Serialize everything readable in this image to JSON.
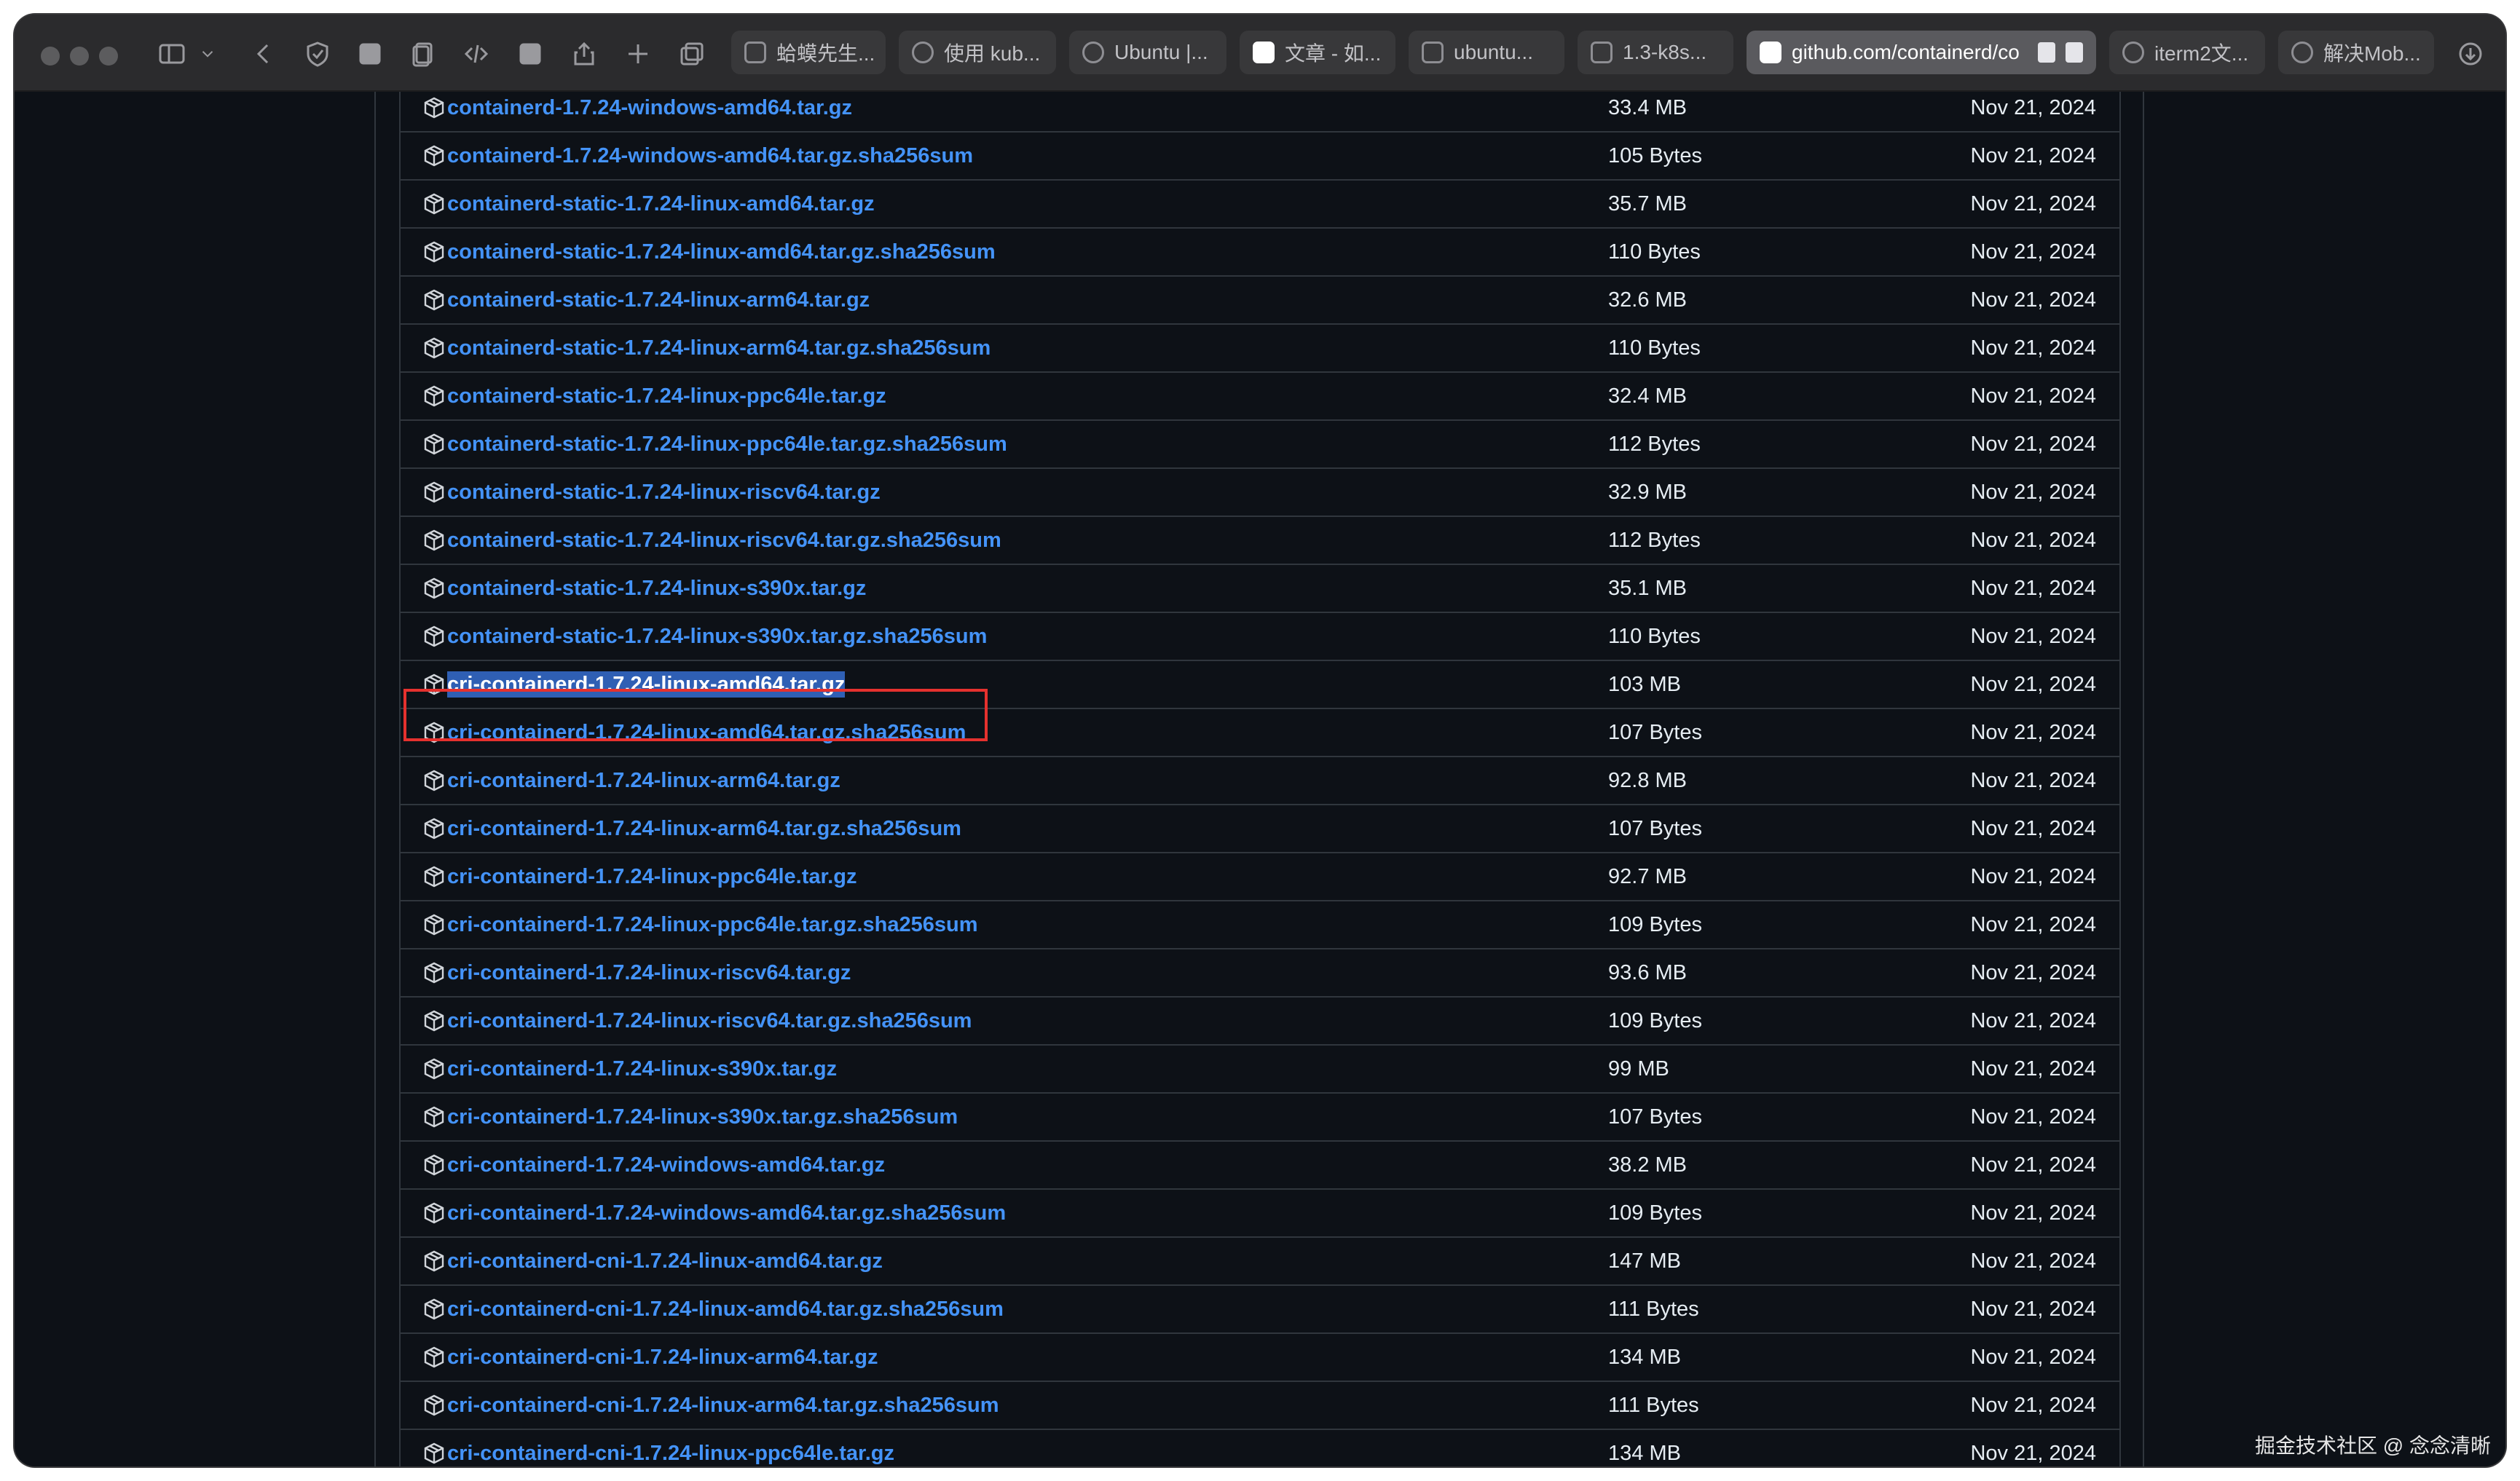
{
  "browser": {
    "tabs": [
      {
        "label": "蛤蟆先生..."
      },
      {
        "label": "使用 kub..."
      },
      {
        "label": "Ubuntu |..."
      },
      {
        "label": "文章 - 如..."
      },
      {
        "label": "ubuntu..."
      },
      {
        "label": "1.3-k8s..."
      },
      {
        "label": "github.com/containerd/co"
      },
      {
        "label": "iterm2文..."
      },
      {
        "label": "解决Mob..."
      }
    ],
    "active_tab_index": 6
  },
  "assets": [
    {
      "name": "containerd-1.7.24-windows-amd64.tar.gz",
      "size": "33.4 MB",
      "date": "Nov 21, 2024"
    },
    {
      "name": "containerd-1.7.24-windows-amd64.tar.gz.sha256sum",
      "size": "105 Bytes",
      "date": "Nov 21, 2024"
    },
    {
      "name": "containerd-static-1.7.24-linux-amd64.tar.gz",
      "size": "35.7 MB",
      "date": "Nov 21, 2024"
    },
    {
      "name": "containerd-static-1.7.24-linux-amd64.tar.gz.sha256sum",
      "size": "110 Bytes",
      "date": "Nov 21, 2024"
    },
    {
      "name": "containerd-static-1.7.24-linux-arm64.tar.gz",
      "size": "32.6 MB",
      "date": "Nov 21, 2024"
    },
    {
      "name": "containerd-static-1.7.24-linux-arm64.tar.gz.sha256sum",
      "size": "110 Bytes",
      "date": "Nov 21, 2024"
    },
    {
      "name": "containerd-static-1.7.24-linux-ppc64le.tar.gz",
      "size": "32.4 MB",
      "date": "Nov 21, 2024"
    },
    {
      "name": "containerd-static-1.7.24-linux-ppc64le.tar.gz.sha256sum",
      "size": "112 Bytes",
      "date": "Nov 21, 2024"
    },
    {
      "name": "containerd-static-1.7.24-linux-riscv64.tar.gz",
      "size": "32.9 MB",
      "date": "Nov 21, 2024"
    },
    {
      "name": "containerd-static-1.7.24-linux-riscv64.tar.gz.sha256sum",
      "size": "112 Bytes",
      "date": "Nov 21, 2024"
    },
    {
      "name": "containerd-static-1.7.24-linux-s390x.tar.gz",
      "size": "35.1 MB",
      "date": "Nov 21, 2024"
    },
    {
      "name": "containerd-static-1.7.24-linux-s390x.tar.gz.sha256sum",
      "size": "110 Bytes",
      "date": "Nov 21, 2024"
    },
    {
      "name": "cri-containerd-1.7.24-linux-amd64.tar.gz",
      "size": "103 MB",
      "date": "Nov 21, 2024"
    },
    {
      "name": "cri-containerd-1.7.24-linux-amd64.tar.gz.sha256sum",
      "size": "107 Bytes",
      "date": "Nov 21, 2024"
    },
    {
      "name": "cri-containerd-1.7.24-linux-arm64.tar.gz",
      "size": "92.8 MB",
      "date": "Nov 21, 2024"
    },
    {
      "name": "cri-containerd-1.7.24-linux-arm64.tar.gz.sha256sum",
      "size": "107 Bytes",
      "date": "Nov 21, 2024"
    },
    {
      "name": "cri-containerd-1.7.24-linux-ppc64le.tar.gz",
      "size": "92.7 MB",
      "date": "Nov 21, 2024"
    },
    {
      "name": "cri-containerd-1.7.24-linux-ppc64le.tar.gz.sha256sum",
      "size": "109 Bytes",
      "date": "Nov 21, 2024"
    },
    {
      "name": "cri-containerd-1.7.24-linux-riscv64.tar.gz",
      "size": "93.6 MB",
      "date": "Nov 21, 2024"
    },
    {
      "name": "cri-containerd-1.7.24-linux-riscv64.tar.gz.sha256sum",
      "size": "109 Bytes",
      "date": "Nov 21, 2024"
    },
    {
      "name": "cri-containerd-1.7.24-linux-s390x.tar.gz",
      "size": "99 MB",
      "date": "Nov 21, 2024"
    },
    {
      "name": "cri-containerd-1.7.24-linux-s390x.tar.gz.sha256sum",
      "size": "107 Bytes",
      "date": "Nov 21, 2024"
    },
    {
      "name": "cri-containerd-1.7.24-windows-amd64.tar.gz",
      "size": "38.2 MB",
      "date": "Nov 21, 2024"
    },
    {
      "name": "cri-containerd-1.7.24-windows-amd64.tar.gz.sha256sum",
      "size": "109 Bytes",
      "date": "Nov 21, 2024"
    },
    {
      "name": "cri-containerd-cni-1.7.24-linux-amd64.tar.gz",
      "size": "147 MB",
      "date": "Nov 21, 2024"
    },
    {
      "name": "cri-containerd-cni-1.7.24-linux-amd64.tar.gz.sha256sum",
      "size": "111 Bytes",
      "date": "Nov 21, 2024"
    },
    {
      "name": "cri-containerd-cni-1.7.24-linux-arm64.tar.gz",
      "size": "134 MB",
      "date": "Nov 21, 2024"
    },
    {
      "name": "cri-containerd-cni-1.7.24-linux-arm64.tar.gz.sha256sum",
      "size": "111 Bytes",
      "date": "Nov 21, 2024"
    },
    {
      "name": "cri-containerd-cni-1.7.24-linux-ppc64le.tar.gz",
      "size": "134 MB",
      "date": "Nov 21, 2024"
    }
  ],
  "selected_asset_index": 12,
  "watermark": "掘金技术社区 @ 念念清晰"
}
